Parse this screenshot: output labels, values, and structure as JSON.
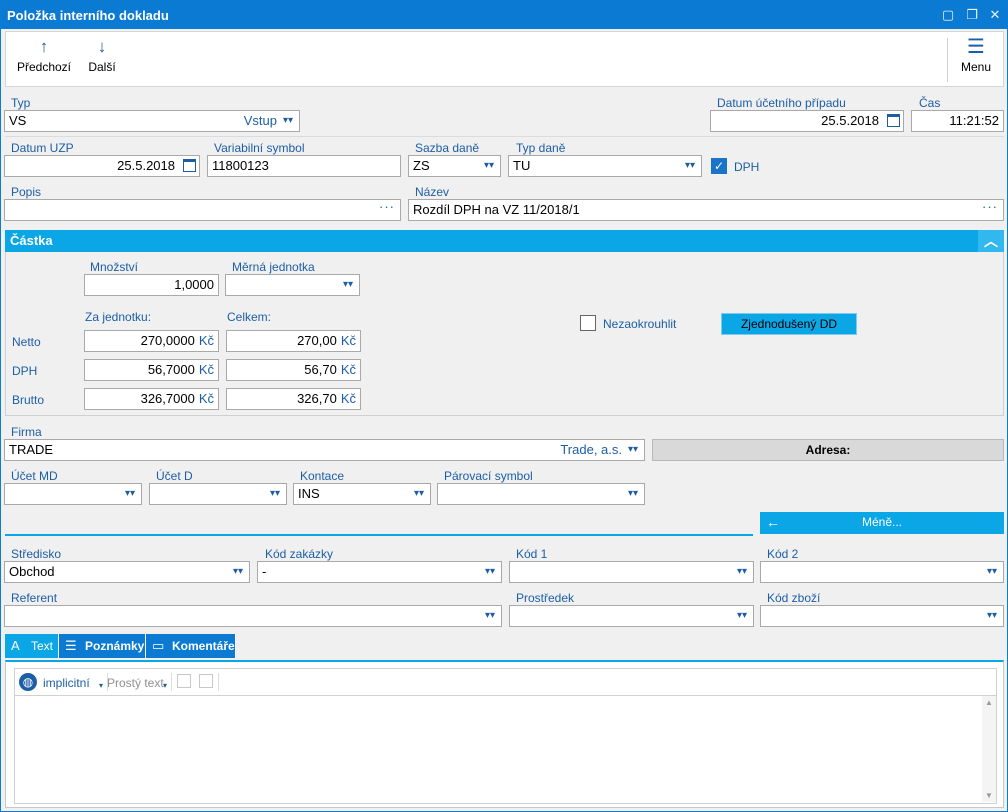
{
  "window": {
    "title": "Položka interního dokladu"
  },
  "toolbar": {
    "prev_label": "Předchozí",
    "next_label": "Další",
    "menu_label": "Menu"
  },
  "header": {
    "typ_label": "Typ",
    "typ_value": "VS",
    "typ_right": "Vstup",
    "datum_ucetniho_label": "Datum účetního případu",
    "datum_ucetniho_value": "25.5.2018",
    "cas_label": "Čas",
    "cas_value": "11:21:52",
    "datum_uzp_label": "Datum UZP",
    "datum_uzp_value": "25.5.2018",
    "var_symbol_label": "Variabilní symbol",
    "var_symbol_value": "11800123",
    "sazba_label": "Sazba daně",
    "sazba_value": "ZS",
    "typ_dane_label": "Typ daně",
    "typ_dane_value": "TU",
    "dph_check_label": "DPH",
    "popis_label": "Popis",
    "popis_value": "",
    "nazev_label": "Název",
    "nazev_value": "Rozdíl DPH na VZ 11/2018/1"
  },
  "castka": {
    "section_title": "Částka",
    "mnozstvi_label": "Množství",
    "mnozstvi_value": "1,0000",
    "merna_label": "Měrná jednotka",
    "merna_value": "",
    "za_jednotku_label": "Za jednotku:",
    "celkem_label": "Celkem:",
    "currency": "Kč",
    "rows": [
      {
        "label": "Netto",
        "unit": "270,0000",
        "total": "270,00"
      },
      {
        "label": "DPH",
        "unit": "56,7000",
        "total": "56,70"
      },
      {
        "label": "Brutto",
        "unit": "326,7000",
        "total": "326,70"
      }
    ],
    "nezaokrouhlit_label": "Nezaokrouhlit",
    "zjednoduseny_label": "Zjednodušený DD"
  },
  "firma": {
    "label": "Firma",
    "value": "TRADE",
    "right": "Trade, a.s.",
    "adresa_label": "Adresa:"
  },
  "ucty": {
    "md_label": "Účet MD",
    "md_value": "",
    "d_label": "Účet D",
    "d_value": "",
    "kontace_label": "Kontace",
    "kontace_value": "INS",
    "parovaci_label": "Párovací symbol",
    "parovaci_value": ""
  },
  "mene_label": "Méně...",
  "dims": {
    "stredisko_label": "Středisko",
    "stredisko_value": "Obchod",
    "kod_zakazky_label": "Kód zakázky",
    "kod_zakazky_value": "-",
    "kod1_label": "Kód 1",
    "kod1_value": "",
    "kod2_label": "Kód 2",
    "kod2_value": "",
    "referent_label": "Referent",
    "referent_value": "",
    "prostredek_label": "Prostředek",
    "prostredek_value": "",
    "kod_zbozi_label": "Kód zboží",
    "kod_zbozi_value": ""
  },
  "tabs": [
    {
      "label": "Text",
      "icon": "text-icon"
    },
    {
      "label": "Poznámky",
      "icon": "notes-icon"
    },
    {
      "label": "Komentáře",
      "icon": "comments-icon"
    }
  ],
  "editor": {
    "language": "implicitní",
    "format": "Prostý text"
  },
  "colors": {
    "accent": "#0aa6e6",
    "title": "#0b7ad2",
    "label": "#1c5ea6"
  }
}
